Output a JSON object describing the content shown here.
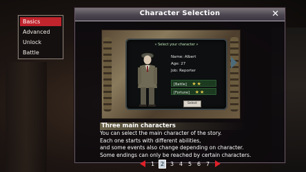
{
  "menu": {
    "items": [
      {
        "label": "Basics",
        "active": true
      },
      {
        "label": "Advanced",
        "active": false
      },
      {
        "label": "Unlock",
        "active": false
      },
      {
        "label": "Battle",
        "active": false
      }
    ]
  },
  "dialog": {
    "title": "Character Selection",
    "close_glyph": "✕"
  },
  "preview": {
    "header": "« Select your character »",
    "name": "Name: Albert",
    "age": "Age: 27",
    "job": "Job: Reporter",
    "battle_label": "[Battle]",
    "battle_stars": "★★",
    "fortune_label": "[Fortune]",
    "fortune_stars": "★★",
    "select_label": "Select"
  },
  "description": {
    "heading": "Three main characters",
    "lines": [
      "You can select the main character of the story.",
      "Each one starts with different abilities,",
      "and some events also change depending on character.",
      "Some endings can only be reached by certain characters."
    ]
  },
  "pagination": {
    "pages": [
      "1",
      "2",
      "3",
      "4",
      "5",
      "6",
      "7"
    ],
    "current": "2"
  },
  "colors": {
    "accent_red": "#c0242c",
    "star_gold": "#e6c94a"
  }
}
